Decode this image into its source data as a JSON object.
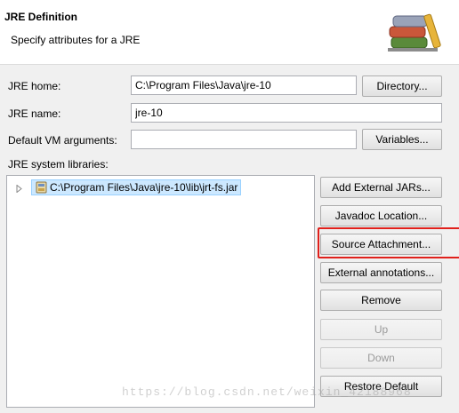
{
  "header": {
    "title": "JRE Definition",
    "subtitle": "Specify attributes for a JRE",
    "icon": "library-books-icon"
  },
  "form": {
    "jre_home_label": "JRE home:",
    "jre_home_value": "C:\\Program Files\\Java\\jre-10",
    "directory_button": "Directory...",
    "jre_name_label": "JRE name:",
    "jre_name_value": "jre-10",
    "vm_args_label": "Default VM arguments:",
    "vm_args_value": "",
    "variables_button": "Variables...",
    "libraries_label": "JRE system libraries:"
  },
  "libraries": {
    "items": [
      {
        "label": "C:\\Program Files\\Java\\jre-10\\lib\\jrt-fs.jar",
        "icon": "jar-file-icon",
        "selected": true,
        "expanded": false
      }
    ]
  },
  "buttons": {
    "add_external_jars": "Add External JARs...",
    "javadoc_location": "Javadoc Location...",
    "source_attachment": "Source Attachment...",
    "external_annotations": "External annotations...",
    "remove": "Remove",
    "up": "Up",
    "down": "Down",
    "restore_default": "Restore Default"
  },
  "watermark": "https://blog.csdn.net/weixin_42188968",
  "colors": {
    "highlight": "#e0201b",
    "selection": "#cce8ff"
  }
}
